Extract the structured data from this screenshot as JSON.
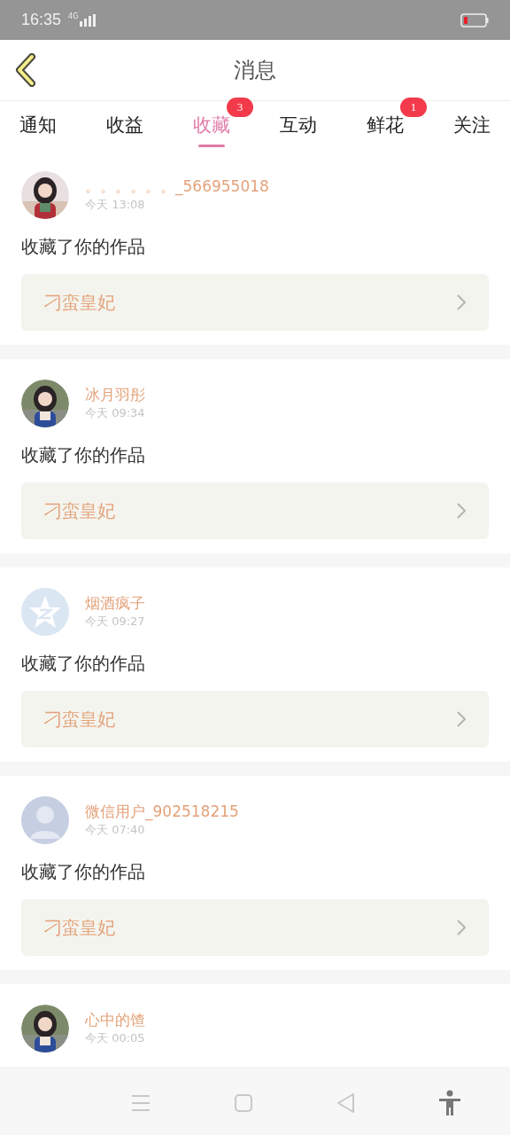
{
  "status_bar": {
    "time": "16:35",
    "network": "4G"
  },
  "header": {
    "title": "消息"
  },
  "tabs": [
    {
      "label": "通知",
      "selected": false
    },
    {
      "label": "收益",
      "selected": false
    },
    {
      "label": "收藏",
      "selected": true,
      "badge": "3"
    },
    {
      "label": "互动",
      "selected": false
    },
    {
      "label": "鲜花",
      "selected": false,
      "badge": "1"
    },
    {
      "label": "关注",
      "selected": false
    }
  ],
  "messages": [
    {
      "name": "。。。。。。_566955018",
      "time": "今天 13:08",
      "text": "收藏了你的作品",
      "book": "刁蛮皇妃"
    },
    {
      "name": "冰月羽彤",
      "time": "今天 09:34",
      "text": "收藏了你的作品",
      "book": "刁蛮皇妃"
    },
    {
      "avatar": {
        "kind": "star"
      },
      "name": "烟酒疯子",
      "time": "今天 09:27",
      "text": "收藏了你的作品",
      "book": "刁蛮皇妃"
    },
    {
      "avatar": {
        "kind": "silhouette"
      },
      "name": "微信用户_902518215",
      "time": "今天 07:40",
      "text": "收藏了你的作品",
      "book": "刁蛮皇妃"
    },
    {
      "name": "心中的馇",
      "time": "今天 00:05"
    }
  ]
}
